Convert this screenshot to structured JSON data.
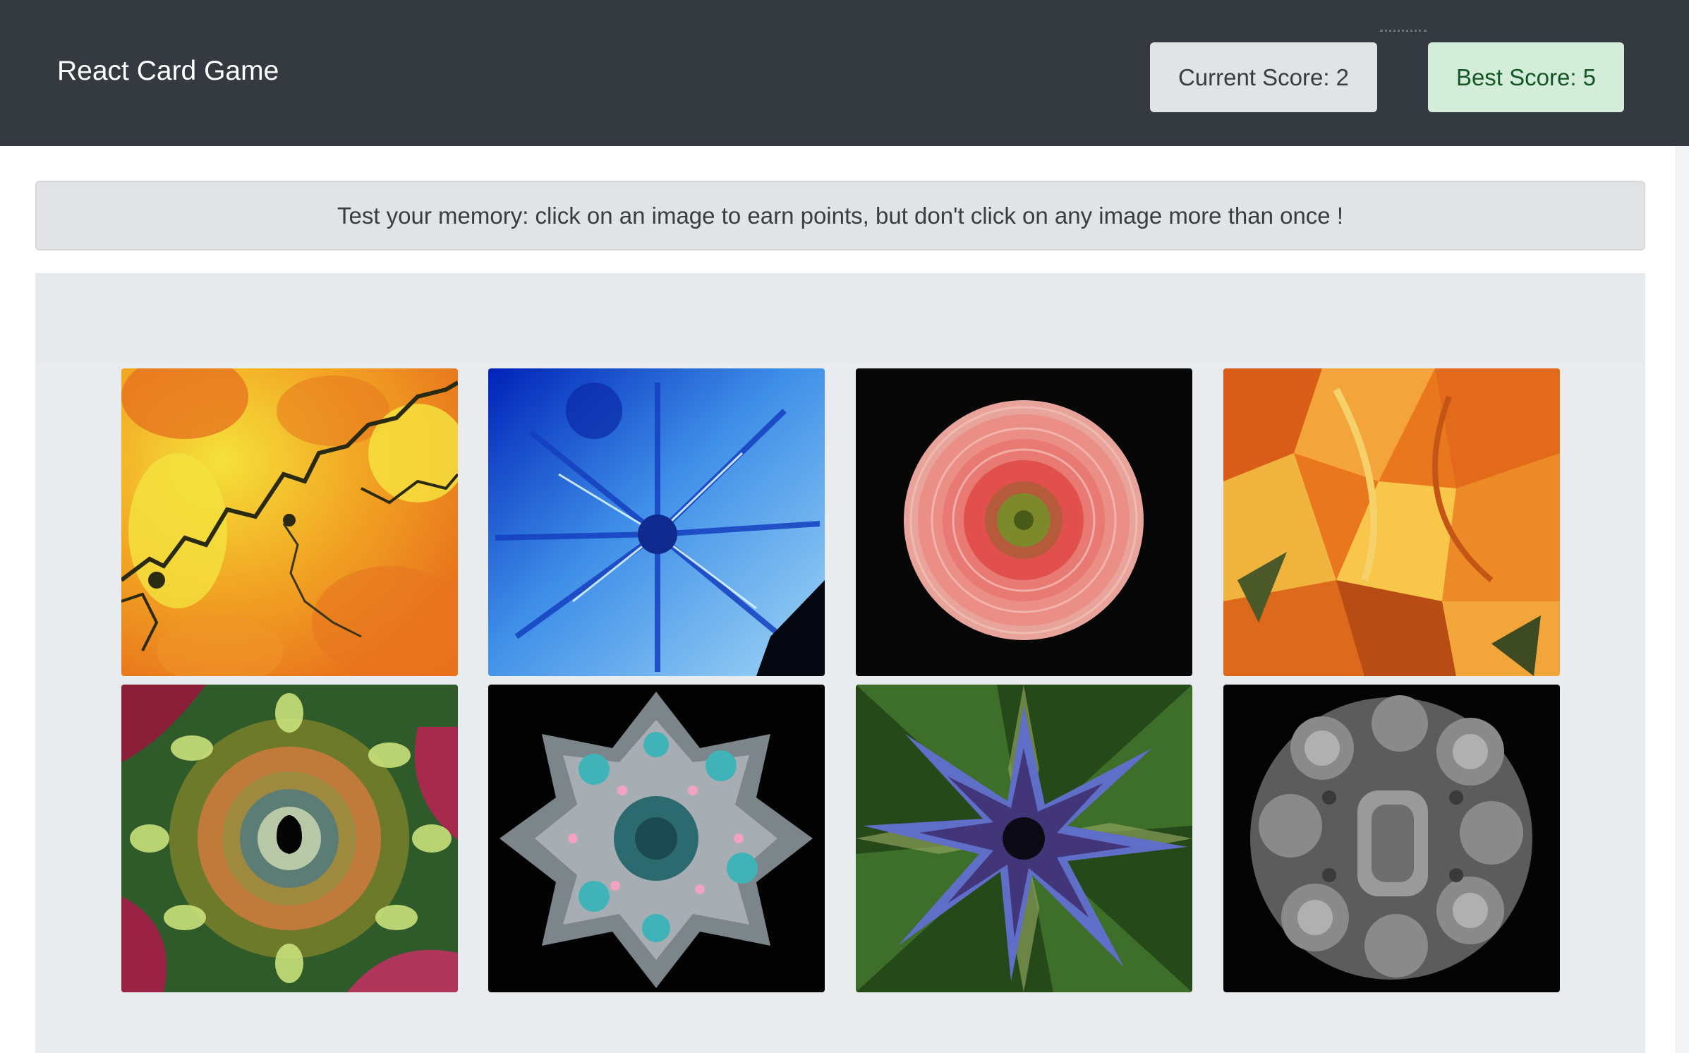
{
  "navbar": {
    "brand": "React Card Game",
    "current_score": "Current Score: 2",
    "best_score": "Best Score: 5"
  },
  "instructions": "Test your memory: click on an image to earn points, but don't click on any image more than once !",
  "cards": [
    {
      "name": "yellow-orange-fractal-image"
    },
    {
      "name": "blue-snowflake-fractal-image"
    },
    {
      "name": "pink-flower-image"
    },
    {
      "name": "orange-swirl-fractal-image"
    },
    {
      "name": "green-spiral-fractal-image"
    },
    {
      "name": "teal-snowflake-fractal-image"
    },
    {
      "name": "green-blue-star-fractal-image"
    },
    {
      "name": "gray-3d-fractal-image"
    }
  ],
  "colors": {
    "navbar": "#343a40",
    "current_score_bg": "#e2e3e5",
    "best_score_bg": "#d4edda",
    "best_score_text": "#155724",
    "jumbotron": "#e9ecef"
  }
}
